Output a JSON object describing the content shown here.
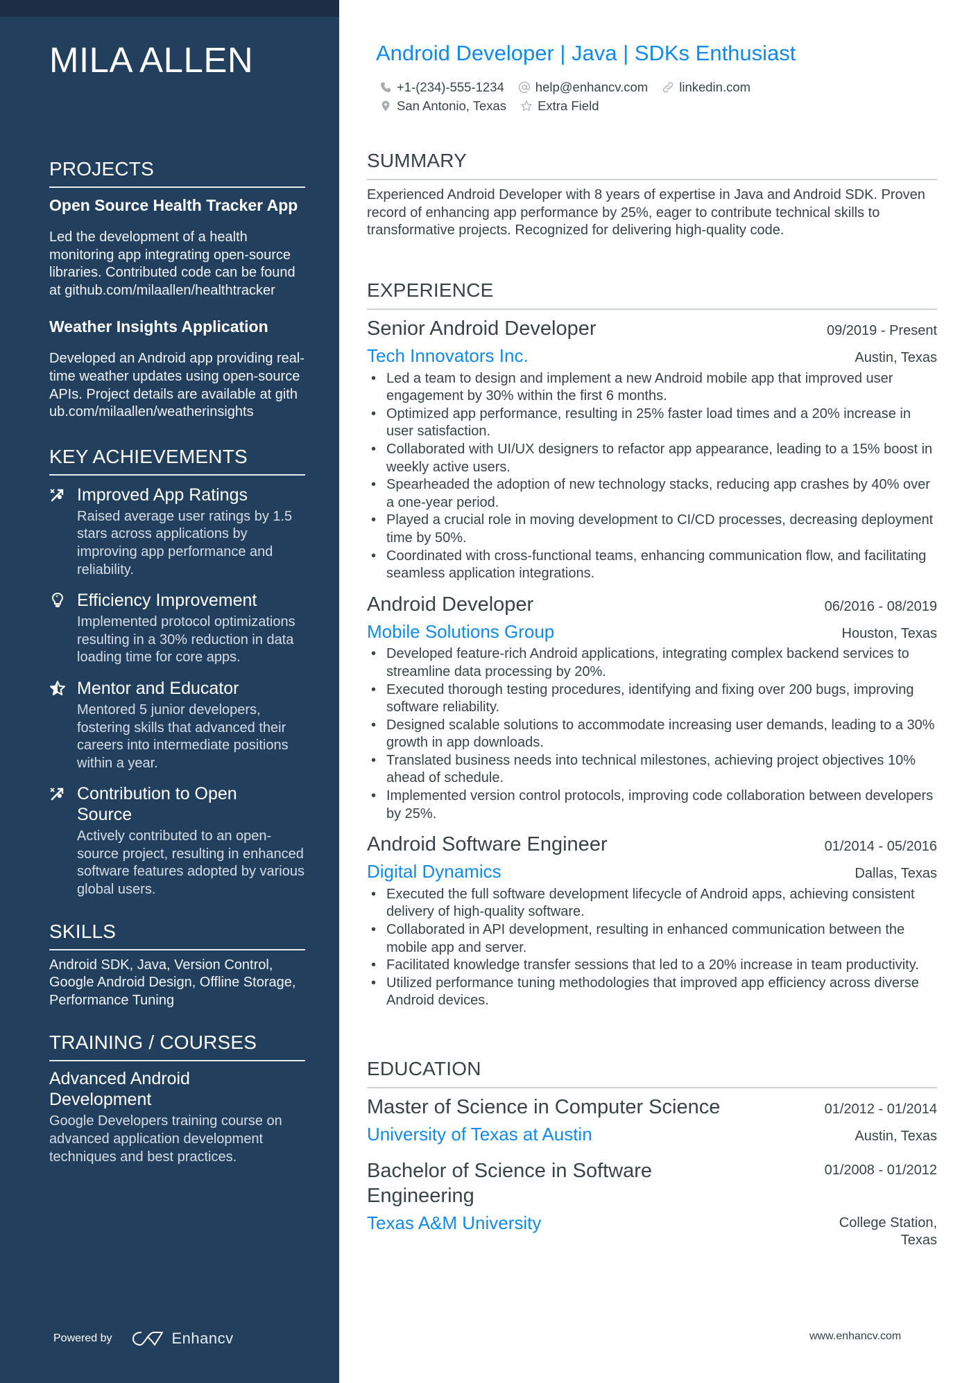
{
  "sidebar": {
    "name": "MILA ALLEN",
    "projects": {
      "title": "PROJECTS",
      "items": [
        {
          "title": "Open Source Health Tracker App",
          "description": "Led the development of a health monitoring app integrating open-source libraries. Contributed code can be found at github.com/milaallen/healthtracker"
        },
        {
          "title": "Weather Insights Application",
          "description": "Developed an Android app providing real-time weather updates using open-source APIs. Project details are available at github.com/milaallen/weatherinsights"
        }
      ]
    },
    "achievements": {
      "title": "KEY ACHIEVEMENTS",
      "items": [
        {
          "icon": "growth-arrow-icon",
          "title": "Improved App Ratings",
          "description": "Raised average user ratings by 1.5 stars across applications by improving app performance and reliability."
        },
        {
          "icon": "lightbulb-icon",
          "title": "Efficiency Improvement",
          "description": "Implemented protocol optimizations resulting in a 30% reduction in data loading time for core apps."
        },
        {
          "icon": "star-half-icon",
          "title": "Mentor and Educator",
          "description": "Mentored 5 junior developers, fostering skills that advanced their careers into intermediate positions within a year."
        },
        {
          "icon": "growth-arrow-icon",
          "title": "Contribution to Open Source",
          "description": "Actively contributed to an open-source project, resulting in enhanced software features adopted by various global users."
        }
      ]
    },
    "skills": {
      "title": "SKILLS",
      "text": "Android SDK, Java, Version Control, Google Android Design, Offline Storage, Performance Tuning"
    },
    "training": {
      "title": "TRAINING / COURSES",
      "items": [
        {
          "title": "Advanced Android Development",
          "description": "Google Developers training course on advanced application development techniques and best practices."
        }
      ]
    },
    "powered_by": {
      "label": "Powered by",
      "brand": "Enhancv"
    }
  },
  "header": {
    "headline": "Android Developer | Java | SDKs Enthusiast",
    "contacts": {
      "phone": "+1-(234)-555-1234",
      "email": "help@enhancv.com",
      "linkedin": "linkedin.com",
      "location": "San Antonio, Texas",
      "extra": "Extra Field"
    }
  },
  "summary": {
    "title": "SUMMARY",
    "text": "Experienced Android Developer with 8 years of expertise in Java and Android SDK. Proven record of enhancing app performance by 25%, eager to contribute technical skills to transformative projects. Recognized for delivering high-quality code."
  },
  "experience": {
    "title": "EXPERIENCE",
    "jobs": [
      {
        "role": "Senior Android Developer",
        "dates": "09/2019 - Present",
        "company": "Tech Innovators Inc.",
        "location": "Austin, Texas",
        "bullets": [
          "Led a team to design and implement a new Android mobile app that improved user engagement by 30% within the first 6 months.",
          "Optimized app performance, resulting in 25% faster load times and a 20% increase in user satisfaction.",
          "Collaborated with UI/UX designers to refactor app appearance, leading to a 15% boost in weekly active users.",
          "Spearheaded the adoption of new technology stacks, reducing app crashes by 40% over a one-year period.",
          "Played a crucial role in moving development to CI/CD processes, decreasing deployment time by 50%.",
          "Coordinated with cross-functional teams, enhancing communication flow, and facilitating seamless application integrations."
        ]
      },
      {
        "role": "Android Developer",
        "dates": "06/2016 - 08/2019",
        "company": "Mobile Solutions Group",
        "location": "Houston, Texas",
        "bullets": [
          "Developed feature-rich Android applications, integrating complex backend services to streamline data processing by 20%.",
          "Executed thorough testing procedures, identifying and fixing over 200 bugs, improving software reliability.",
          "Designed scalable solutions to accommodate increasing user demands, leading to a 30% growth in app downloads.",
          "Translated business needs into technical milestones, achieving project objectives 10% ahead of schedule.",
          "Implemented version control protocols, improving code collaboration between developers by 25%."
        ]
      },
      {
        "role": "Android Software Engineer",
        "dates": "01/2014 - 05/2016",
        "company": "Digital Dynamics",
        "location": "Dallas, Texas",
        "bullets": [
          "Executed the full software development lifecycle of Android apps, achieving consistent delivery of high-quality software.",
          "Collaborated in API development, resulting in enhanced communication between the mobile app and server.",
          "Facilitated knowledge transfer sessions that led to a 20% increase in team productivity.",
          "Utilized performance tuning methodologies that improved app efficiency across diverse Android devices."
        ]
      }
    ]
  },
  "education": {
    "title": "EDUCATION",
    "items": [
      {
        "degree": "Master of Science in Computer Science",
        "dates": "01/2012 - 01/2014",
        "school": "University of Texas at Austin",
        "location": "Austin, Texas"
      },
      {
        "degree": "Bachelor of Science in Software Engineering",
        "dates": "01/2008 - 01/2012",
        "school": "Texas A&M University",
        "location": "College Station, Texas"
      }
    ]
  },
  "footer": {
    "url": "www.enhancv.com"
  },
  "colors": {
    "sidebar_bg": "#22405e",
    "sidebar_top": "#1b2e46",
    "accent": "#0f8aef",
    "text": "#384347"
  }
}
